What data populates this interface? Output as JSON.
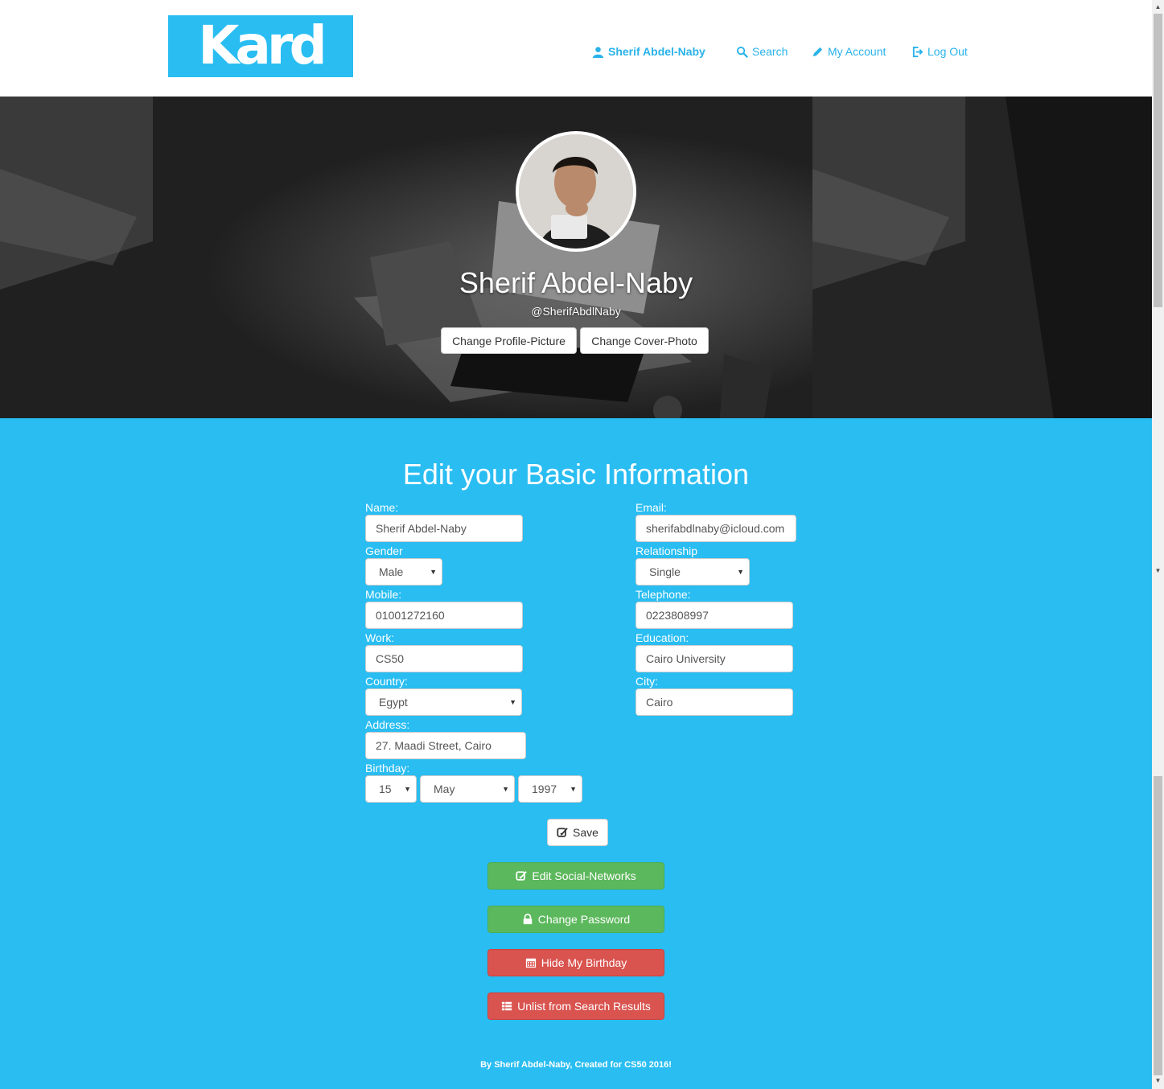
{
  "brand": {
    "logo_text": "Kard",
    "accent": "#29bdf2"
  },
  "nav": {
    "user": "Sherif Abdel-Naby",
    "search": "Search",
    "account": "My Account",
    "logout": "Log Out"
  },
  "profile": {
    "name": "Sherif Abdel-Naby",
    "handle": "@SherifAbdlNaby",
    "change_picture": "Change Profile-Picture",
    "change_cover": "Change Cover-Photo"
  },
  "form": {
    "title": "Edit your Basic Information",
    "name_label": "Name:",
    "name_value": "Sherif Abdel-Naby",
    "email_label": "Email:",
    "email_value": "sherifabdlnaby@icloud.com",
    "gender_label": "Gender",
    "gender_value": "Male",
    "relationship_label": "Relationship",
    "relationship_value": "Single",
    "mobile_label": "Mobile:",
    "mobile_value": "01001272160",
    "telephone_label": "Telephone:",
    "telephone_value": "0223808997",
    "work_label": "Work:",
    "work_value": "CS50",
    "education_label": "Education:",
    "education_value": "Cairo University",
    "country_label": "Country:",
    "country_value": "Egypt",
    "city_label": "City:",
    "city_value": "Cairo",
    "address_label": "Address:",
    "address_value": "27. Maadi Street, Cairo",
    "birthday_label": "Birthday:",
    "birth_day": "15",
    "birth_month": "May",
    "birth_year": "1997"
  },
  "actions": {
    "save": "Save",
    "edit_social": "Edit Social-Networks",
    "change_password": "Change Password",
    "hide_birthday": "Hide My Birthday",
    "unlist": "Unlist from Search Results"
  },
  "footer": {
    "text": "By Sherif Abdel-Naby, Created for CS50 2016!"
  },
  "colors": {
    "green": "#5cb85c",
    "red": "#d9534f",
    "link": "#29b2ea"
  }
}
